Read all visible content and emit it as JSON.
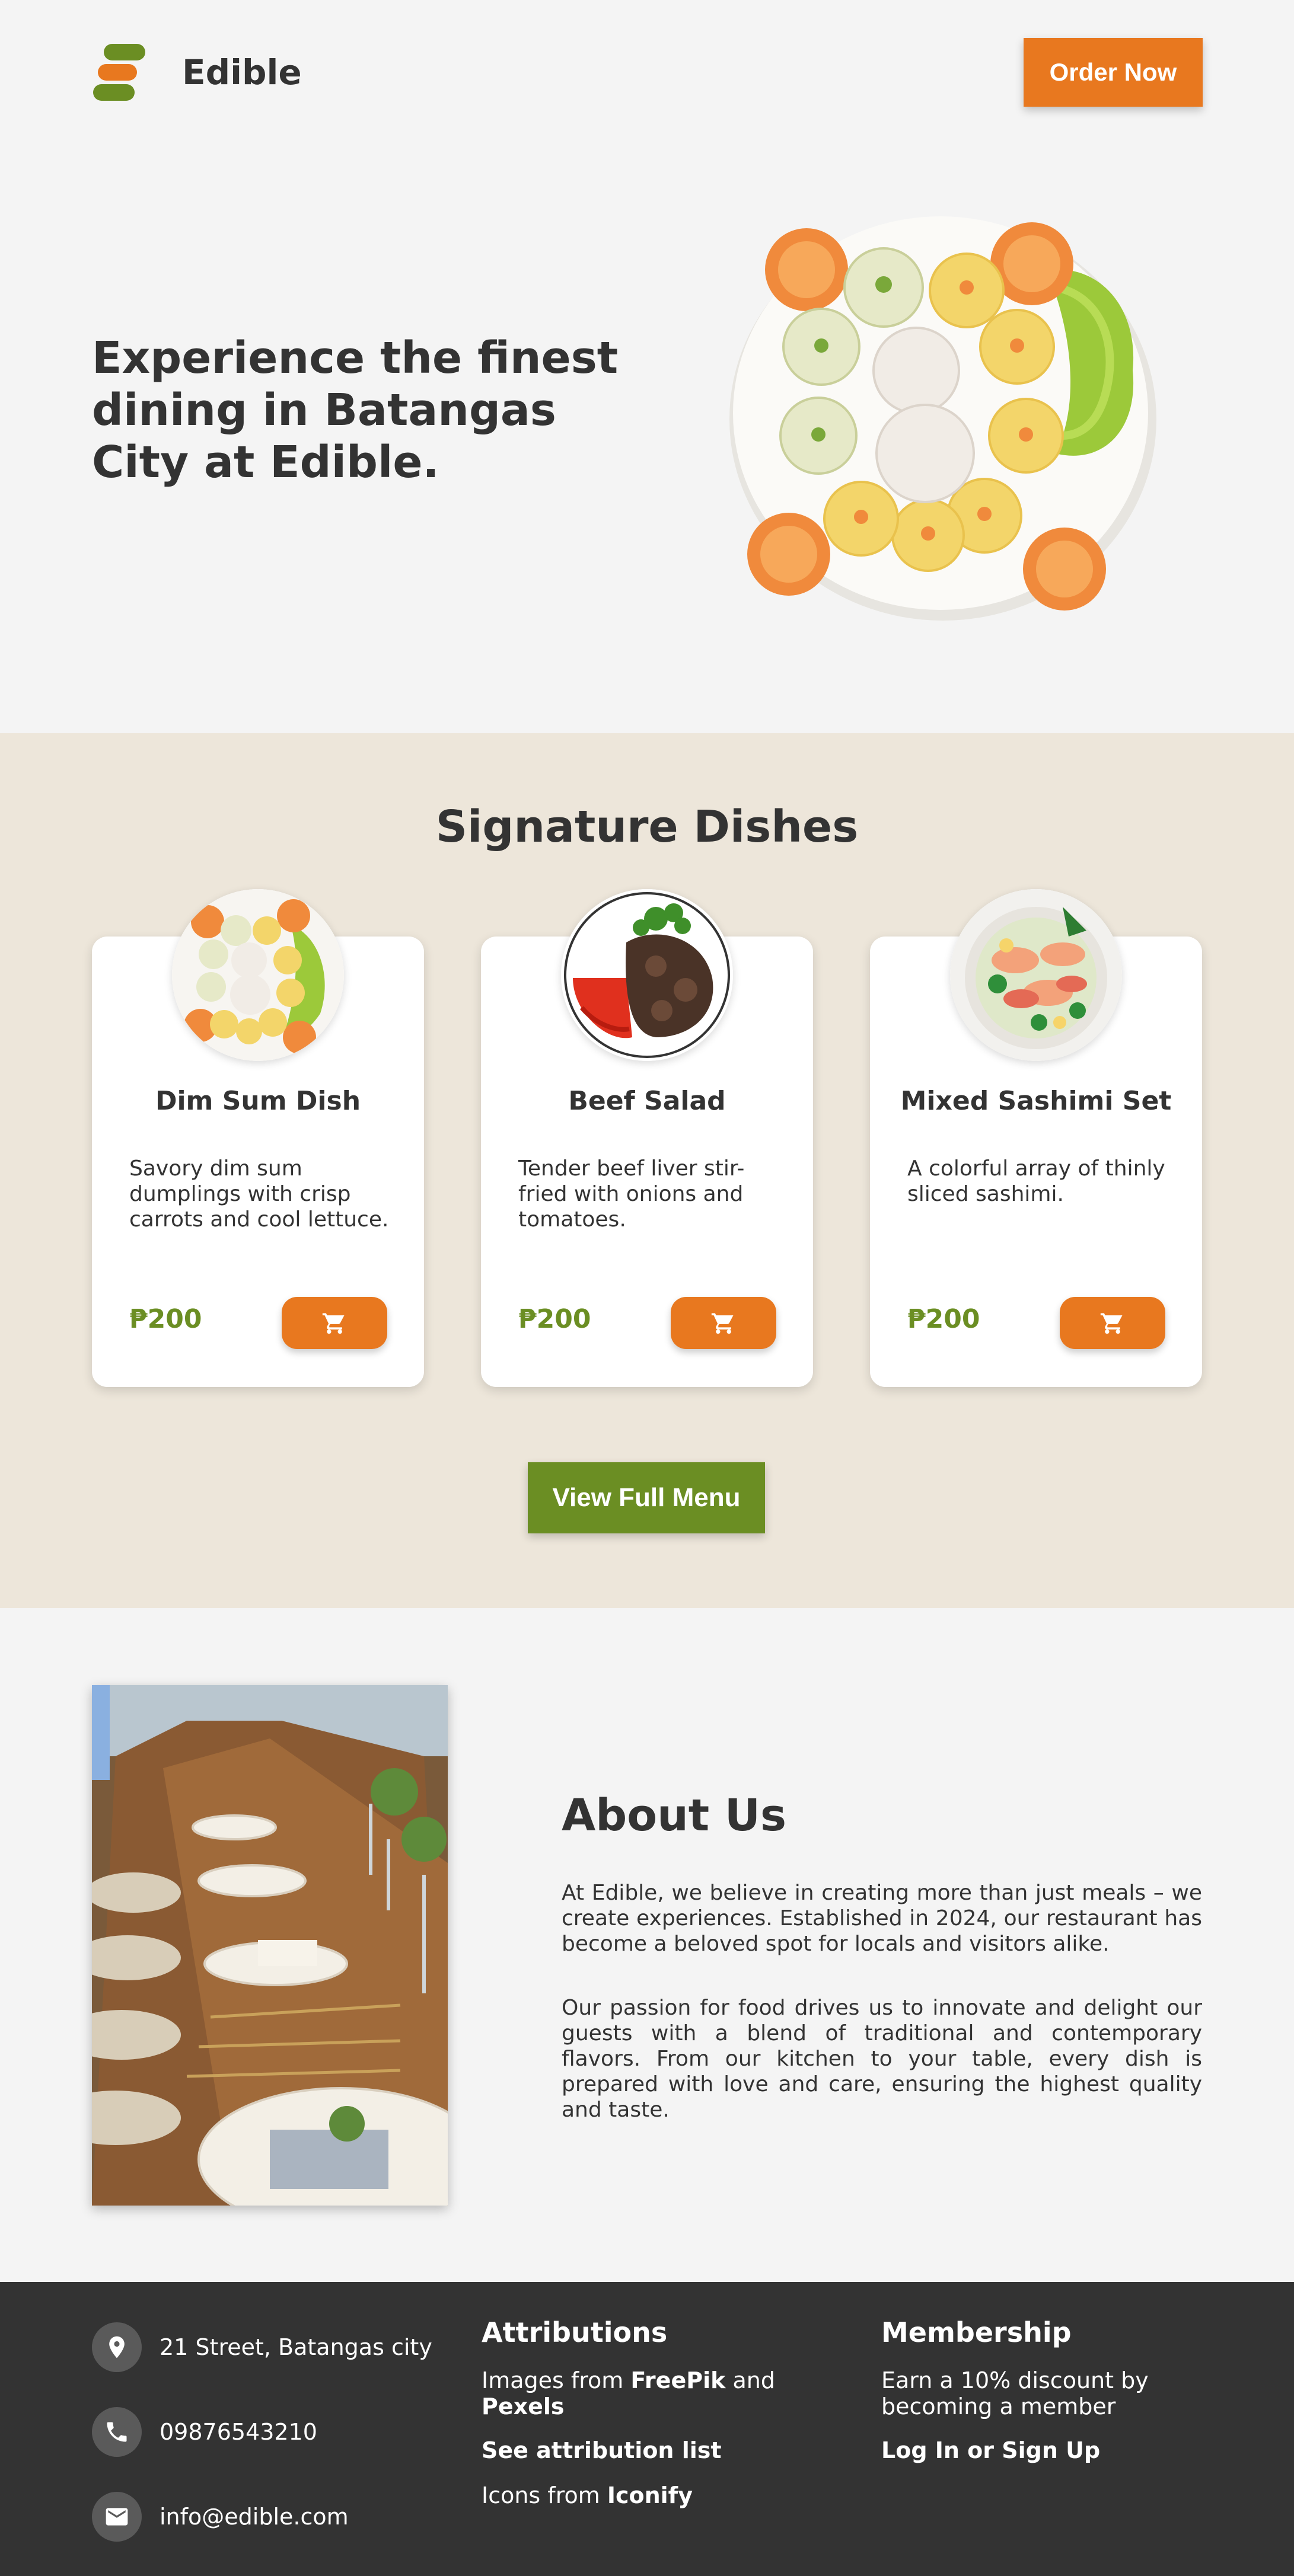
{
  "header": {
    "brand": "Edible",
    "order_button": "Order Now"
  },
  "hero": {
    "title": "Experience the finest dining in Batangas City at Edible."
  },
  "signature": {
    "title": "Signature Dishes",
    "cards": [
      {
        "name": "Dim Sum Dish",
        "description": "Savory dim sum dumplings with crisp carrots and cool lettuce.",
        "price": "₱200",
        "image_icon": "dim-sum-plate"
      },
      {
        "name": "Beef Salad",
        "description": "Tender beef liver stir-fried with onions and tomatoes.",
        "price": "₱200",
        "image_icon": "beef-salad-plate"
      },
      {
        "name": "Mixed Sashimi Set",
        "description": "A colorful array of thinly sliced sashimi.",
        "price": "₱200",
        "image_icon": "sashimi-bowl"
      }
    ],
    "view_menu_button": "View Full Menu"
  },
  "about": {
    "title": "About Us",
    "paragraph1": "At Edible, we believe in creating more than just meals – we create experiences. Established in 2024, our restaurant has become a beloved spot for locals and visitors alike.",
    "paragraph2": "Our passion for food drives us to innovate and delight our guests with a blend of traditional and contemporary flavors. From our kitchen to your table, every dish is prepared with love and care, ensuring the highest quality and taste."
  },
  "footer": {
    "contacts": [
      {
        "icon": "location-pin-icon",
        "text": "21 Street, Batangas city"
      },
      {
        "icon": "phone-icon",
        "text": "09876543210"
      },
      {
        "icon": "email-icon",
        "text": "info@edible.com"
      }
    ],
    "attributions": {
      "heading": "Attributions",
      "images_prefix": "Images from ",
      "freepik": "FreePik",
      "and": " and ",
      "pexels": "Pexels",
      "attribution_list_link": "See attribution list",
      "icons_prefix": "Icons from ",
      "iconify": "Iconify"
    },
    "membership": {
      "heading": "Membership",
      "text": "Earn a 10% discount by becoming a member",
      "login_link": "Log In or Sign Up"
    }
  },
  "colors": {
    "accent_orange": "#e8781f",
    "accent_green": "#6b8e23",
    "background": "#f4f4f4",
    "section_beige": "#ede6da",
    "footer": "#333333"
  }
}
